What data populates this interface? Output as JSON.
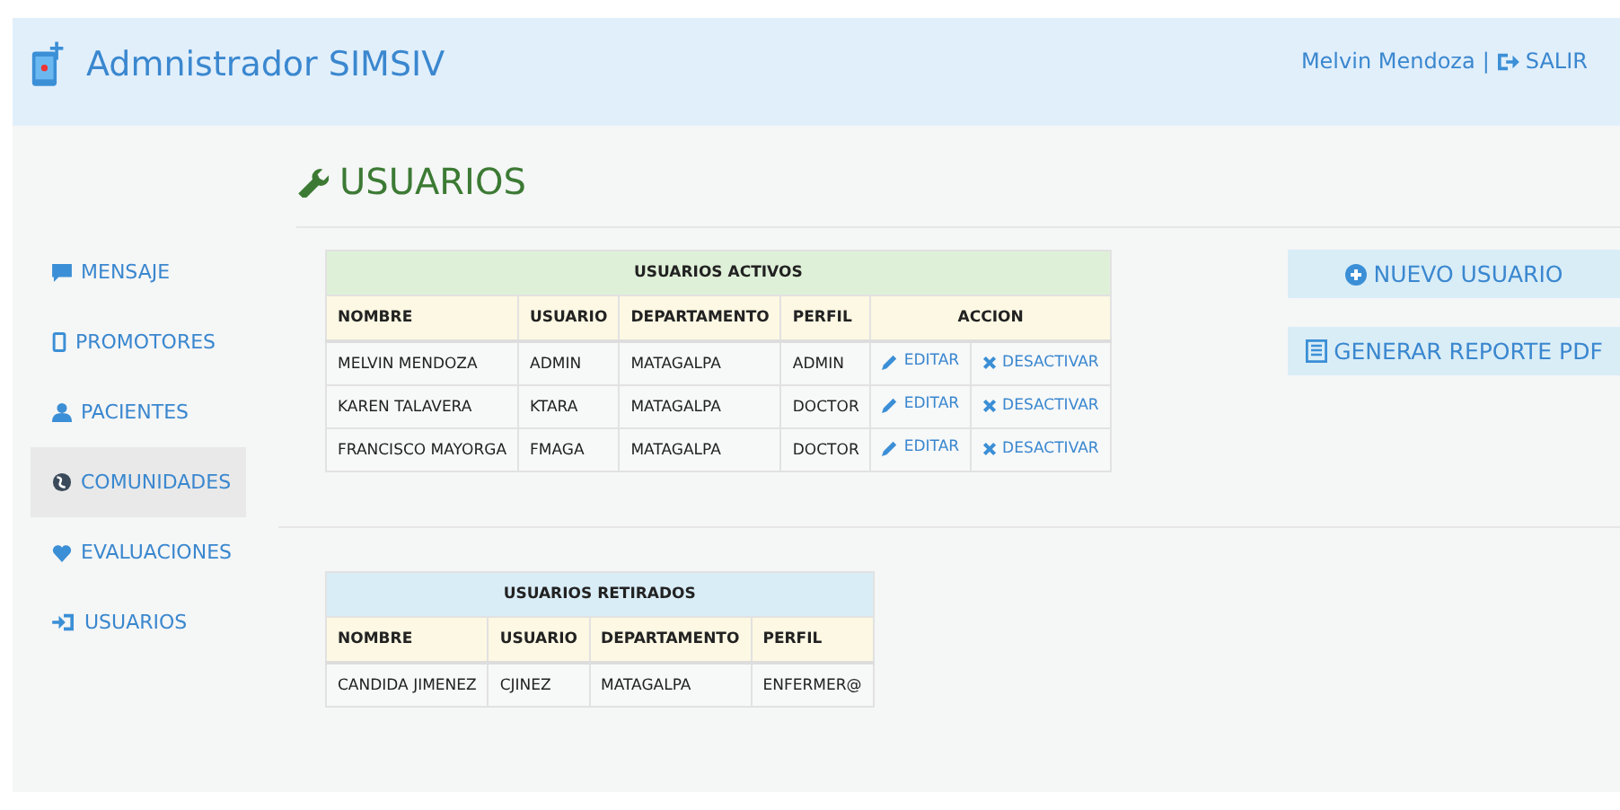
{
  "header": {
    "title": "Admnistrador SIMSIV",
    "user": "Melvin Mendoza",
    "separator": "|",
    "logout": "SALIR"
  },
  "sidebar": {
    "items": [
      {
        "label": "MENSAJE",
        "selected": false
      },
      {
        "label": "PROMOTORES",
        "selected": false
      },
      {
        "label": "PACIENTES",
        "selected": false
      },
      {
        "label": "COMUNIDADES",
        "selected": true
      },
      {
        "label": "EVALUACIONES",
        "selected": false
      },
      {
        "label": "USUARIOS",
        "selected": false
      }
    ]
  },
  "page_title": "USUARIOS",
  "active_table": {
    "title": "USUARIOS ACTIVOS",
    "columns": [
      "NOMBRE",
      "USUARIO",
      "DEPARTAMENTO",
      "PERFIL",
      "ACCION"
    ],
    "rows": [
      {
        "cells": [
          "MELVIN MENDOZA",
          "ADMIN",
          "MATAGALPA",
          "ADMIN"
        ],
        "actions": [
          "EDITAR",
          "DESACTIVAR"
        ]
      },
      {
        "cells": [
          "KAREN TALAVERA",
          "KTARA",
          "MATAGALPA",
          "DOCTOR"
        ],
        "actions": [
          "EDITAR",
          "DESACTIVAR"
        ]
      },
      {
        "cells": [
          "FRANCISCO MAYORGA",
          "FMAGA",
          "MATAGALPA",
          "DOCTOR"
        ],
        "actions": [
          "EDITAR",
          "DESACTIVAR"
        ]
      }
    ]
  },
  "buttons": [
    "NUEVO USUARIO",
    "GENERAR REPORTE PDF"
  ],
  "retired_table": {
    "title": "USUARIOS RETIRADOS",
    "columns": [
      "NOMBRE",
      "USUARIO",
      "DEPARTAMENTO",
      "PERFIL"
    ],
    "rows": [
      {
        "cells": [
          "CANDIDA JIMENEZ",
          "CJINEZ",
          "MATAGALPA",
          "ENFERMER@"
        ]
      }
    ]
  }
}
